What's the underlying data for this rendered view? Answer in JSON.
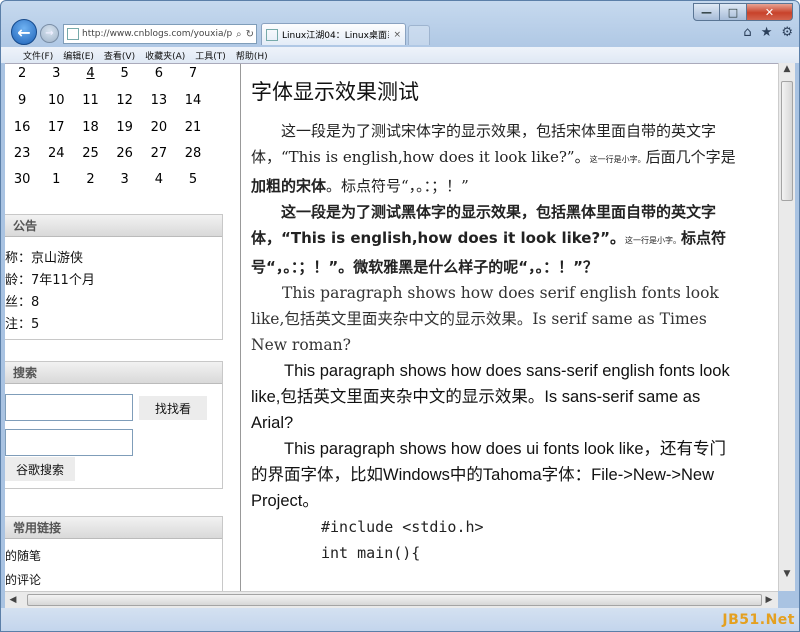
{
  "window": {
    "minimize": "—",
    "maximize": "□",
    "close": "✕"
  },
  "nav": {
    "back_icon": "←",
    "forward_icon": "→",
    "address": "http://www.cnblogs.com/youxia/p",
    "address_search_icon": "⌕",
    "address_refresh_icon": "↻",
    "tab_title": "Linux江湖04：Linux桌面系...",
    "tab_close": "×",
    "home_icon": "⌂",
    "favorites_icon": "★",
    "tools_icon": "⚙"
  },
  "menu": [
    "文件(F)",
    "编辑(E)",
    "查看(V)",
    "收藏夹(A)",
    "工具(T)",
    "帮助(H)"
  ],
  "calendar": {
    "rows": [
      [
        "2",
        "3",
        "4",
        "5",
        "6",
        "7"
      ],
      [
        "9",
        "10",
        "11",
        "12",
        "13",
        "14"
      ],
      [
        "16",
        "17",
        "18",
        "19",
        "20",
        "21"
      ],
      [
        "23",
        "24",
        "25",
        "26",
        "27",
        "28"
      ],
      [
        "30",
        "1",
        "2",
        "3",
        "4",
        "5"
      ]
    ]
  },
  "notice": {
    "title": "公告",
    "lines": [
      "称：京山游侠",
      "龄：7年11个月",
      "丝：8",
      "注：5"
    ]
  },
  "search": {
    "title": "搜索",
    "find_button": "找找看",
    "google_button": "谷歌搜索"
  },
  "links": {
    "title": "常用链接",
    "items": [
      "的随笔",
      "的评论"
    ]
  },
  "article": {
    "title": "字体显示效果测试",
    "p1_a": "这一段是为了测试宋体字的显示效果，包括宋体里面自带的英文字体，“This is english,how does it look like?”。",
    "p1_small": "这一行是小字。",
    "p1_b": "后面几个字是",
    "p1_bold": "加粗的宋体",
    "p1_c": "。标点符号“，。：；！”",
    "p2_a": "这一段是为了测试黑体字的显示效果，包括黑体里面自带的英文字体，“This is english,how does it look like?”。",
    "p2_small": "这一行是小字。",
    "p2_b": "标点符号“，。：；！”。微软雅黑是什么样子的呢“，。：！”？",
    "p3": "This paragraph shows how does serif english fonts look like,包括英文里面夹杂中文的显示效果。Is serif same as Times New roman?",
    "p4": "This paragraph shows how does sans-serif english fonts look like,包括英文里面夹杂中文的显示效果。Is sans-serif same as Arial?",
    "p5": "This paragraph shows how does ui fonts look like，还有专门的界面字体，比如Windows中的Tahoma字体：File->New->New Project。",
    "code1": "#include <stdio.h>",
    "code2": "int main(){"
  },
  "scroll": {
    "up": "▲",
    "down": "▼",
    "left": "◀",
    "right": "▶"
  },
  "watermark": "JB51.Net"
}
